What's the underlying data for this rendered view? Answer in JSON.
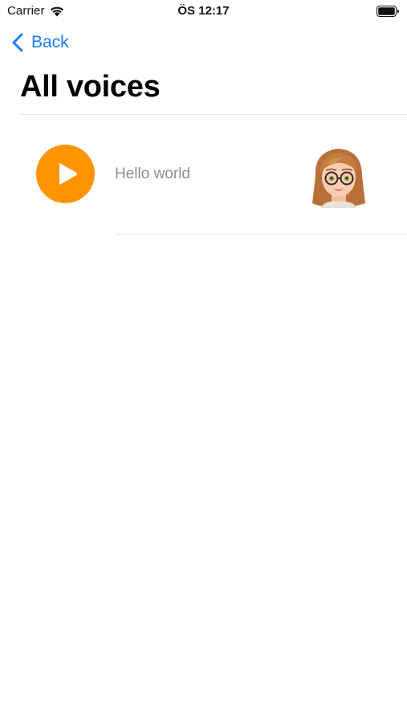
{
  "status_bar": {
    "carrier": "Carrier",
    "time": "ÖS 12:17",
    "icons": [
      "wifi-icon",
      "battery-icon"
    ]
  },
  "nav": {
    "back_label": "Back",
    "back_icon": "chevron-left-icon"
  },
  "page": {
    "title": "All voices"
  },
  "voices": [
    {
      "text": "Hello world",
      "play_icon": "play-icon",
      "avatar": "memoji-avatar-girl-glasses"
    }
  ],
  "colors": {
    "accent": "#1a7cf5",
    "play_button": "#fe9500",
    "secondary_text": "#8e8e8e",
    "divider": "#e6e6e6"
  }
}
